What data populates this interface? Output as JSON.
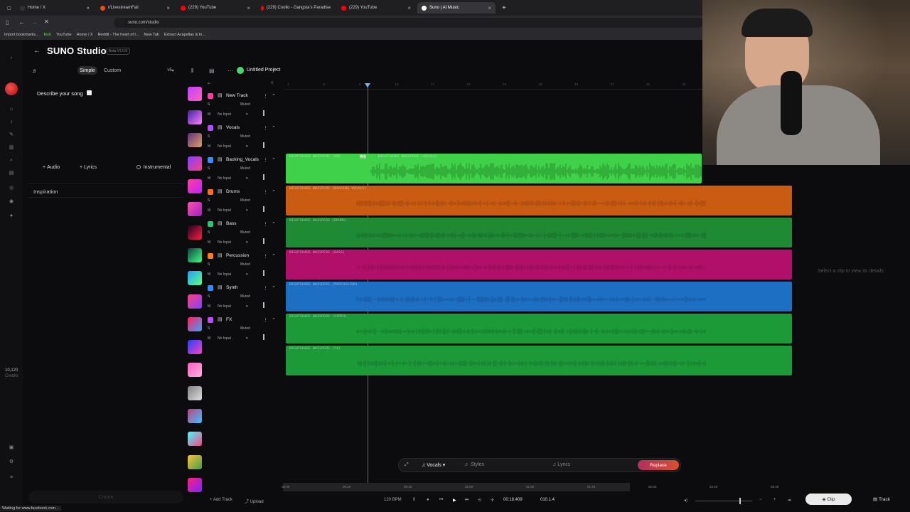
{
  "browser": {
    "tabs": [
      {
        "label": "Home / X",
        "favicon_color": "#222"
      },
      {
        "label": "r/LivestreamFail",
        "favicon_color": "#ff4500"
      },
      {
        "label": "(229) YouTube",
        "favicon_color": "#ff0000"
      },
      {
        "label": "(229) Coolio - Gangsta's Paradise",
        "favicon_color": "#ff0000"
      },
      {
        "label": "(229) YouTube",
        "favicon_color": "#ff0000"
      },
      {
        "label": "Suno | AI Music",
        "favicon_color": "#fff"
      }
    ],
    "url": "suno.com/studio",
    "bookmarks": [
      "Import bookmarks...",
      "Kick",
      "YouTube",
      "Home / X",
      "Reddit - The heart of t...",
      "New Tab",
      "Extract Acapellas & In..."
    ],
    "status": "Waiting for www.facebook.com..."
  },
  "header": {
    "title": "SUNO Studio",
    "beta": "Beta V1.0.0"
  },
  "create_panel": {
    "mode_simple": "Simple",
    "mode_custom": "Custom",
    "version": "v5",
    "describe_label": "Describe your song",
    "audio": "Audio",
    "lyrics": "Lyrics",
    "instrumental": "Instrumental",
    "inspiration": "Inspiration",
    "create": "Create"
  },
  "credits": {
    "value": "10,120",
    "label": "Credits"
  },
  "project": {
    "name": "Untitled Project"
  },
  "timeline_ticks": [
    "1",
    "5",
    "9",
    "13",
    "17",
    "21",
    "25",
    "29",
    "33",
    "37",
    "41",
    "45"
  ],
  "tracks": [
    {
      "name": "New Track",
      "muted": "Muted",
      "input": "No Input",
      "color": "#ff3aa3"
    },
    {
      "name": "Vocals",
      "muted": "Muted",
      "input": "No Input",
      "color": "#b44cff",
      "clip": "NIGHTSHADE WHISPERS (VOCALS)",
      "clip_short": "NIGHTSHADE WHISPERS (VOC",
      "clip_mid": "NIG",
      "clip_color": "#3fd14a"
    },
    {
      "name": "Backing_Vocals",
      "muted": "Muted",
      "input": "No Input",
      "color": "#3a8cff",
      "clip": "NIGHTSHADE WHISPERS (BACKING VOCALS)",
      "clip_color": "#c95c12"
    },
    {
      "name": "Drums",
      "muted": "Muted",
      "input": "No Input",
      "color": "#ff6a1f",
      "clip": "NIGHTSHADE WHISPERS (DRUMS)",
      "clip_color": "#1f8a34"
    },
    {
      "name": "Bass",
      "muted": "Muted",
      "input": "No Input",
      "color": "#28c76f",
      "clip": "NIGHTSHADE WHISPERS (BASS)",
      "clip_color": "#b0106a"
    },
    {
      "name": "Percussion",
      "muted": "Muted",
      "input": "No Input",
      "color": "#ff7a1a",
      "clip": "NIGHTSHADE WHISPERS (PERCUSSION)",
      "clip_color": "#1d6fc4"
    },
    {
      "name": "Synth",
      "muted": "Muted",
      "input": "No Input",
      "color": "#2f8cff",
      "clip": "NIGHTSHADE WHISPERS (SYNTH)",
      "clip_color": "#1c9a38"
    },
    {
      "name": "FX",
      "muted": "Muted",
      "input": "No Input",
      "color": "#c04cff",
      "clip": "NIGHTSHADE WHISPERS (FX)",
      "clip_color": "#1c9a38"
    }
  ],
  "details_hint": "Select a clip to view its details",
  "clip_toolbar": {
    "stem": "Vocals",
    "styles": "Styles",
    "lyrics": "Lyrics",
    "replace": "Replace"
  },
  "overview_ticks": [
    "00:00",
    "00:20",
    "00:40",
    "01:00",
    "01:20",
    "01:40",
    "02:00",
    "02:20",
    "02:40"
  ],
  "transport": {
    "bpm": "120 BPM",
    "time": "00:18.409",
    "bar": "010.1.4",
    "add_track": "Add Track",
    "upload": "Upload"
  },
  "view_buttons": {
    "clip": "Clip",
    "track": "Track"
  }
}
